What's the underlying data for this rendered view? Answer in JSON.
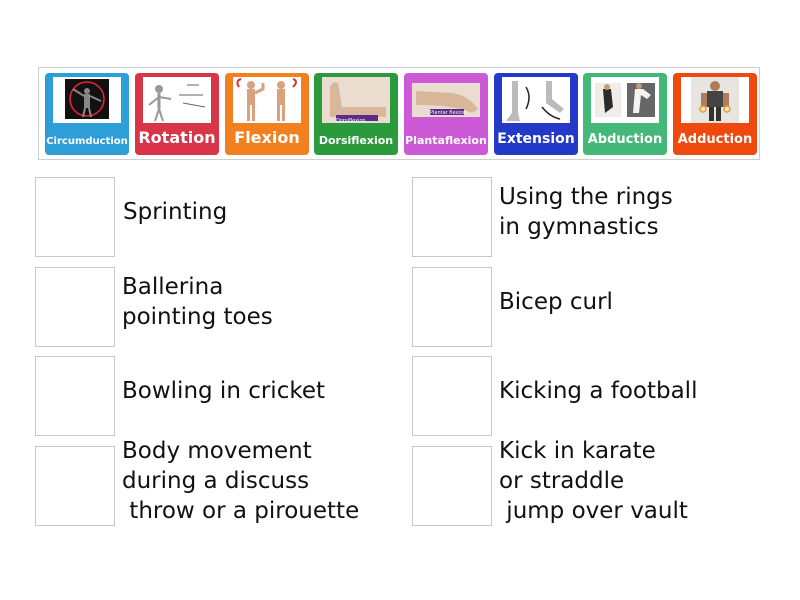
{
  "tiles": [
    {
      "label": "Circumduction",
      "color": "#2e9ed8",
      "icon": "arm-circle-photo-icon"
    },
    {
      "label": "Rotation",
      "color": "#d83548",
      "icon": "skeleton-rotation-diagram-icon"
    },
    {
      "label": "Flexion",
      "color": "#f2801f",
      "icon": "flexion-extension-figures-icon"
    },
    {
      "label": "Dorsiflexion",
      "color": "#2a9a3c",
      "icon": "foot-dorsiflexion-photo-icon",
      "caption": "Dorsiflexion"
    },
    {
      "label": "Plantaflexion",
      "color": "#cc59d6",
      "icon": "foot-plantar-flexion-photo-icon",
      "caption": "Plantar flexion"
    },
    {
      "label": "Extension",
      "color": "#2439c7",
      "icon": "leg-extension-figures-icon"
    },
    {
      "label": "Abduction",
      "color": "#43b878",
      "icon": "karate-kick-photo-icon"
    },
    {
      "label": "Adduction",
      "color": "#f0490f",
      "icon": "rings-gymnast-photo-icon"
    }
  ],
  "items": [
    {
      "text": "Sprinting"
    },
    {
      "text": "Using the rings\nin gymnastics"
    },
    {
      "text": "Ballerina\npointing toes"
    },
    {
      "text": "Bicep curl"
    },
    {
      "text": "Bowling in cricket"
    },
    {
      "text": "Kicking a football"
    },
    {
      "text": "Body movement\nduring a discuss\n throw or a pirouette"
    },
    {
      "text": "Kick in karate\nor straddle\n jump over vault"
    }
  ]
}
